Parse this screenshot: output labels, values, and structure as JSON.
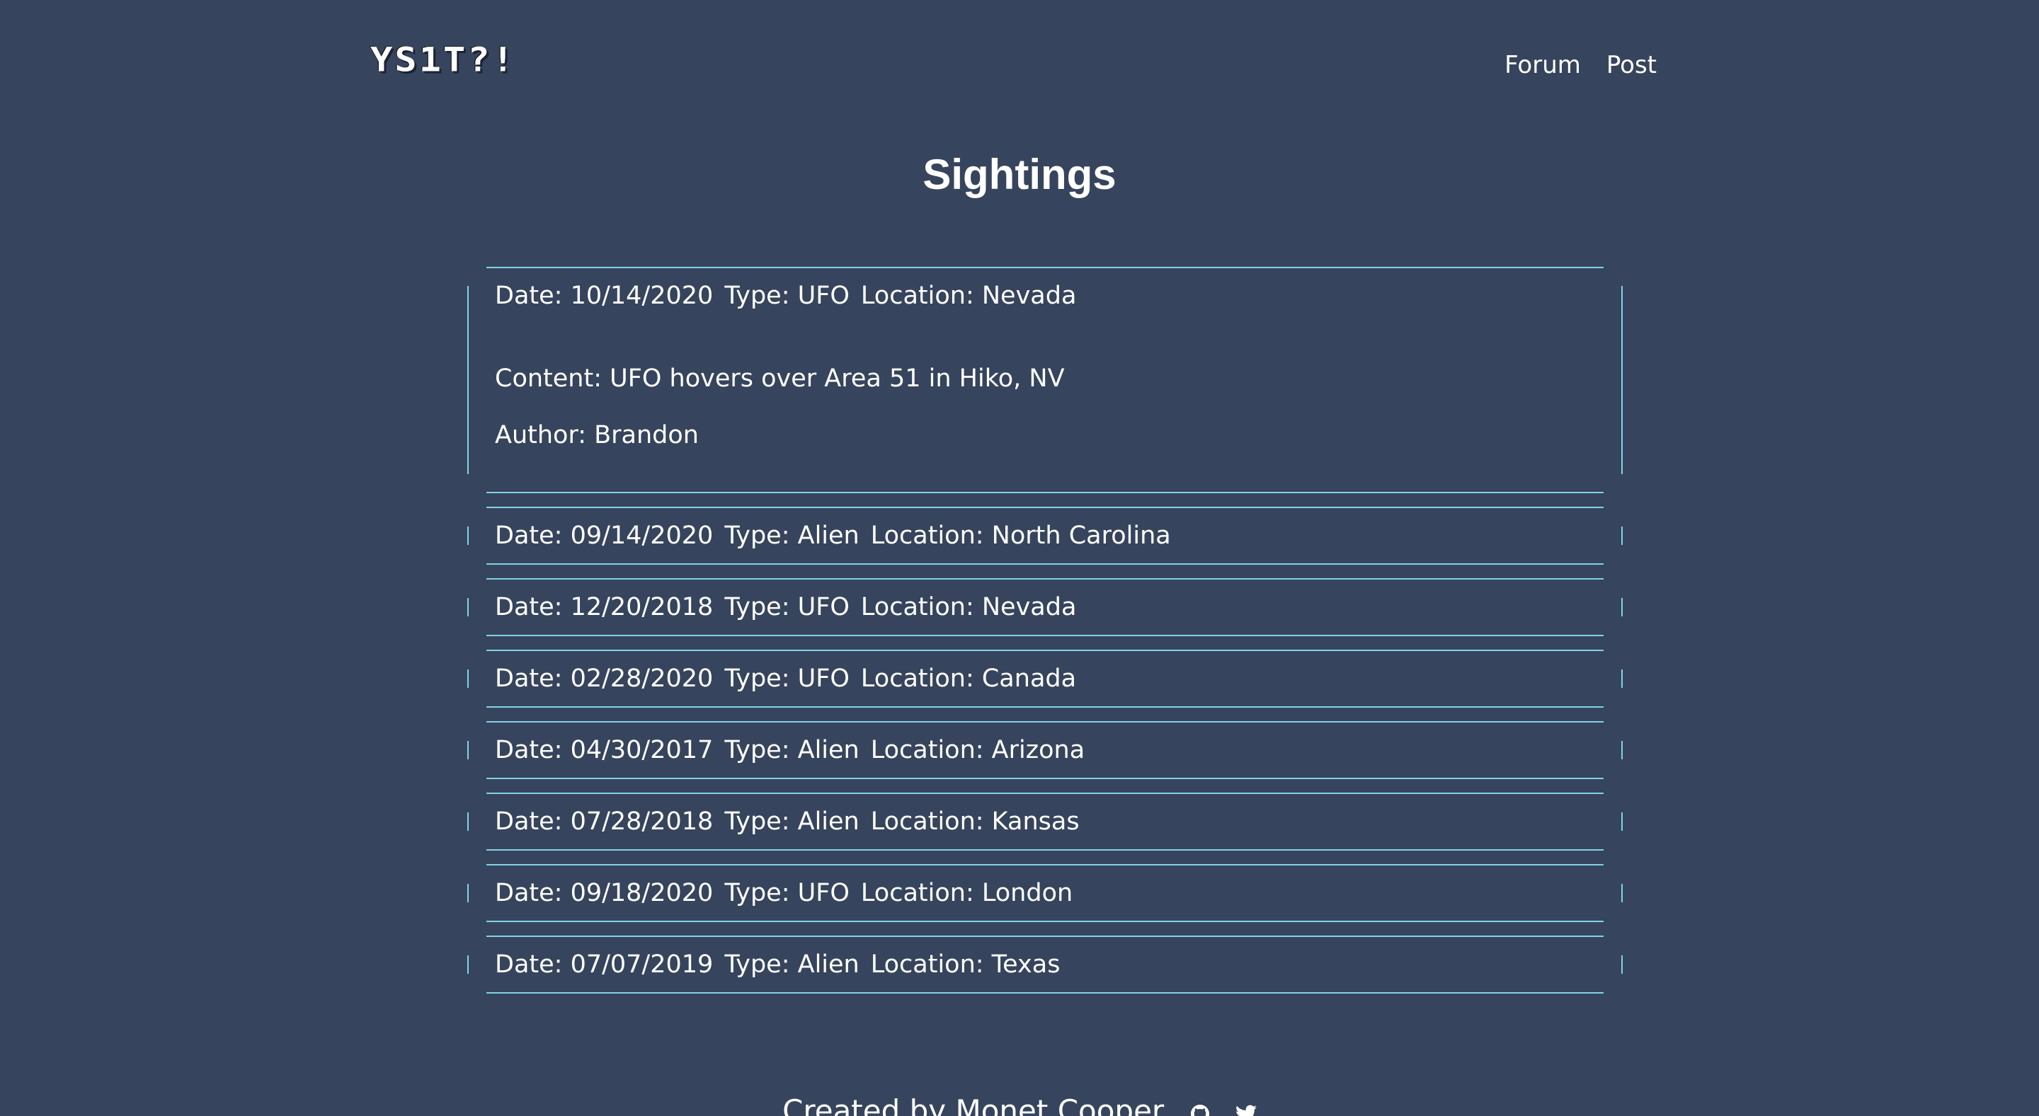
{
  "header": {
    "logo": "YS1T?!",
    "nav": [
      {
        "label": "Forum"
      },
      {
        "label": "Post"
      }
    ]
  },
  "main": {
    "title": "Sightings",
    "sightings": [
      {
        "date": "Date: 10/14/2020",
        "type": "Type: UFO",
        "location": "Location: Nevada",
        "content": "Content: UFO hovers over Area 51 in Hiko, NV",
        "author": "Author: Brandon",
        "expanded": true
      },
      {
        "date": "Date: 09/14/2020",
        "type": "Type: Alien",
        "location": "Location: North Carolina",
        "expanded": false
      },
      {
        "date": "Date: 12/20/2018",
        "type": "Type: UFO",
        "location": "Location: Nevada",
        "expanded": false
      },
      {
        "date": "Date: 02/28/2020",
        "type": "Type: UFO",
        "location": "Location: Canada",
        "expanded": false
      },
      {
        "date": "Date: 04/30/2017",
        "type": "Type: Alien",
        "location": "Location: Arizona",
        "expanded": false
      },
      {
        "date": "Date: 07/28/2018",
        "type": "Type: Alien",
        "location": "Location: Kansas",
        "expanded": false
      },
      {
        "date": "Date: 09/18/2020",
        "type": "Type: UFO",
        "location": "Location: London",
        "expanded": false
      },
      {
        "date": "Date: 07/07/2019",
        "type": "Type: Alien",
        "location": "Location: Texas",
        "expanded": false
      }
    ]
  },
  "footer": {
    "credit": "Created by Monet Cooper",
    "icons": [
      "github-icon",
      "twitter-icon"
    ]
  },
  "colors": {
    "background": "#37445d",
    "accent": "#7fd4e8",
    "text": "#ffffff"
  }
}
